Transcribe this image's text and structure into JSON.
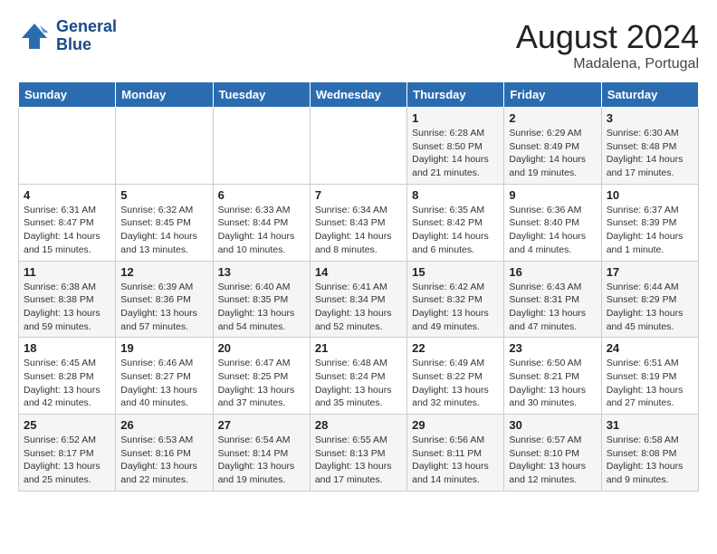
{
  "header": {
    "logo_line1": "General",
    "logo_line2": "Blue",
    "month_title": "August 2024",
    "location": "Madalena, Portugal"
  },
  "weekdays": [
    "Sunday",
    "Monday",
    "Tuesday",
    "Wednesday",
    "Thursday",
    "Friday",
    "Saturday"
  ],
  "weeks": [
    [
      {
        "day": "",
        "info": ""
      },
      {
        "day": "",
        "info": ""
      },
      {
        "day": "",
        "info": ""
      },
      {
        "day": "",
        "info": ""
      },
      {
        "day": "1",
        "info": "Sunrise: 6:28 AM\nSunset: 8:50 PM\nDaylight: 14 hours\nand 21 minutes."
      },
      {
        "day": "2",
        "info": "Sunrise: 6:29 AM\nSunset: 8:49 PM\nDaylight: 14 hours\nand 19 minutes."
      },
      {
        "day": "3",
        "info": "Sunrise: 6:30 AM\nSunset: 8:48 PM\nDaylight: 14 hours\nand 17 minutes."
      }
    ],
    [
      {
        "day": "4",
        "info": "Sunrise: 6:31 AM\nSunset: 8:47 PM\nDaylight: 14 hours\nand 15 minutes."
      },
      {
        "day": "5",
        "info": "Sunrise: 6:32 AM\nSunset: 8:45 PM\nDaylight: 14 hours\nand 13 minutes."
      },
      {
        "day": "6",
        "info": "Sunrise: 6:33 AM\nSunset: 8:44 PM\nDaylight: 14 hours\nand 10 minutes."
      },
      {
        "day": "7",
        "info": "Sunrise: 6:34 AM\nSunset: 8:43 PM\nDaylight: 14 hours\nand 8 minutes."
      },
      {
        "day": "8",
        "info": "Sunrise: 6:35 AM\nSunset: 8:42 PM\nDaylight: 14 hours\nand 6 minutes."
      },
      {
        "day": "9",
        "info": "Sunrise: 6:36 AM\nSunset: 8:40 PM\nDaylight: 14 hours\nand 4 minutes."
      },
      {
        "day": "10",
        "info": "Sunrise: 6:37 AM\nSunset: 8:39 PM\nDaylight: 14 hours\nand 1 minute."
      }
    ],
    [
      {
        "day": "11",
        "info": "Sunrise: 6:38 AM\nSunset: 8:38 PM\nDaylight: 13 hours\nand 59 minutes."
      },
      {
        "day": "12",
        "info": "Sunrise: 6:39 AM\nSunset: 8:36 PM\nDaylight: 13 hours\nand 57 minutes."
      },
      {
        "day": "13",
        "info": "Sunrise: 6:40 AM\nSunset: 8:35 PM\nDaylight: 13 hours\nand 54 minutes."
      },
      {
        "day": "14",
        "info": "Sunrise: 6:41 AM\nSunset: 8:34 PM\nDaylight: 13 hours\nand 52 minutes."
      },
      {
        "day": "15",
        "info": "Sunrise: 6:42 AM\nSunset: 8:32 PM\nDaylight: 13 hours\nand 49 minutes."
      },
      {
        "day": "16",
        "info": "Sunrise: 6:43 AM\nSunset: 8:31 PM\nDaylight: 13 hours\nand 47 minutes."
      },
      {
        "day": "17",
        "info": "Sunrise: 6:44 AM\nSunset: 8:29 PM\nDaylight: 13 hours\nand 45 minutes."
      }
    ],
    [
      {
        "day": "18",
        "info": "Sunrise: 6:45 AM\nSunset: 8:28 PM\nDaylight: 13 hours\nand 42 minutes."
      },
      {
        "day": "19",
        "info": "Sunrise: 6:46 AM\nSunset: 8:27 PM\nDaylight: 13 hours\nand 40 minutes."
      },
      {
        "day": "20",
        "info": "Sunrise: 6:47 AM\nSunset: 8:25 PM\nDaylight: 13 hours\nand 37 minutes."
      },
      {
        "day": "21",
        "info": "Sunrise: 6:48 AM\nSunset: 8:24 PM\nDaylight: 13 hours\nand 35 minutes."
      },
      {
        "day": "22",
        "info": "Sunrise: 6:49 AM\nSunset: 8:22 PM\nDaylight: 13 hours\nand 32 minutes."
      },
      {
        "day": "23",
        "info": "Sunrise: 6:50 AM\nSunset: 8:21 PM\nDaylight: 13 hours\nand 30 minutes."
      },
      {
        "day": "24",
        "info": "Sunrise: 6:51 AM\nSunset: 8:19 PM\nDaylight: 13 hours\nand 27 minutes."
      }
    ],
    [
      {
        "day": "25",
        "info": "Sunrise: 6:52 AM\nSunset: 8:17 PM\nDaylight: 13 hours\nand 25 minutes."
      },
      {
        "day": "26",
        "info": "Sunrise: 6:53 AM\nSunset: 8:16 PM\nDaylight: 13 hours\nand 22 minutes."
      },
      {
        "day": "27",
        "info": "Sunrise: 6:54 AM\nSunset: 8:14 PM\nDaylight: 13 hours\nand 19 minutes."
      },
      {
        "day": "28",
        "info": "Sunrise: 6:55 AM\nSunset: 8:13 PM\nDaylight: 13 hours\nand 17 minutes."
      },
      {
        "day": "29",
        "info": "Sunrise: 6:56 AM\nSunset: 8:11 PM\nDaylight: 13 hours\nand 14 minutes."
      },
      {
        "day": "30",
        "info": "Sunrise: 6:57 AM\nSunset: 8:10 PM\nDaylight: 13 hours\nand 12 minutes."
      },
      {
        "day": "31",
        "info": "Sunrise: 6:58 AM\nSunset: 8:08 PM\nDaylight: 13 hours\nand 9 minutes."
      }
    ]
  ]
}
